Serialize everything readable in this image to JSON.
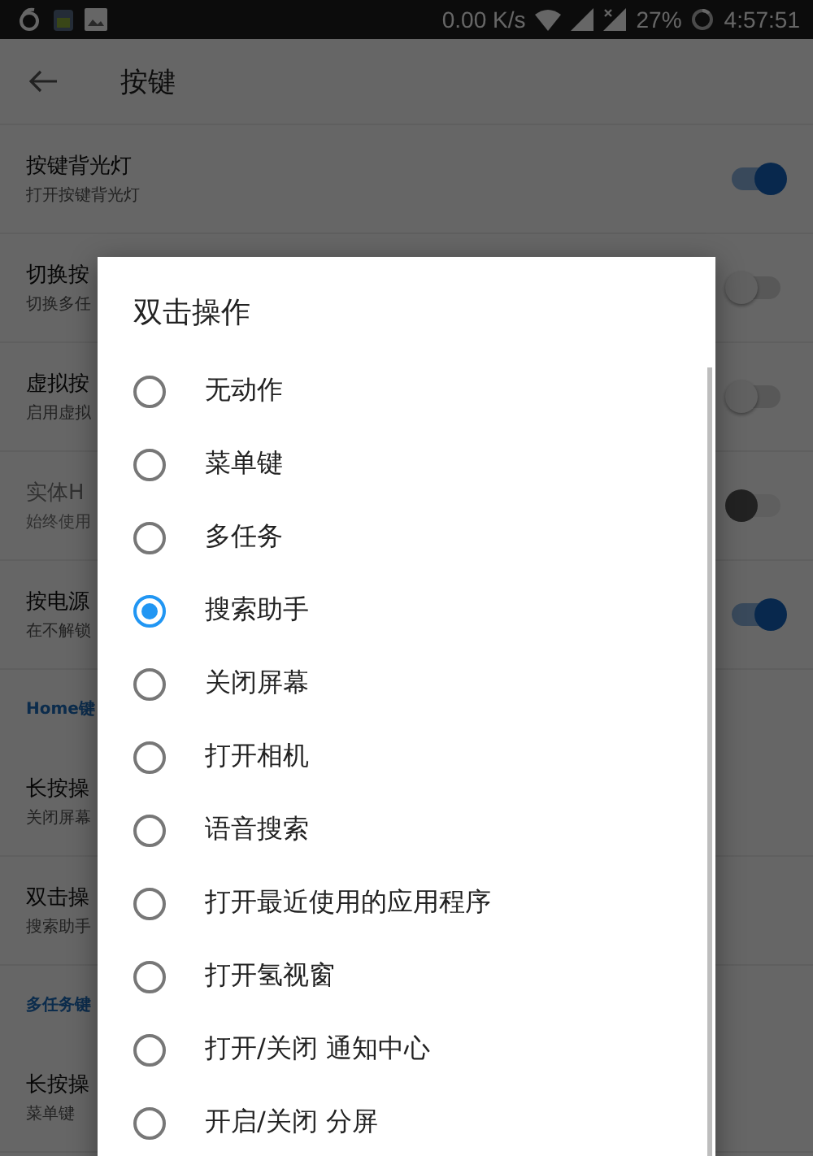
{
  "status_bar": {
    "speed": "0.00 K/s",
    "battery": "27%",
    "time": "4:57:51"
  },
  "toolbar": {
    "title": "按键"
  },
  "settings": [
    {
      "kind": "row",
      "title": "按键背光灯",
      "subtitle": "打开按键背光灯",
      "on": true,
      "disabled": false
    },
    {
      "kind": "row",
      "title": "切换按",
      "subtitle": "切换多任",
      "on": false,
      "disabled": false
    },
    {
      "kind": "row",
      "title": "虚拟按",
      "subtitle": "启用虚拟",
      "on": false,
      "disabled": false
    },
    {
      "kind": "row",
      "title": "实体H",
      "subtitle": "始终使用",
      "on": false,
      "disabled": true
    },
    {
      "kind": "row",
      "title": "按电源",
      "subtitle": "在不解锁",
      "on": true,
      "disabled": false
    },
    {
      "kind": "header",
      "title": "Home键"
    },
    {
      "kind": "plain",
      "title": "长按操",
      "subtitle": "关闭屏幕"
    },
    {
      "kind": "plain",
      "title": "双击操",
      "subtitle": "搜索助手"
    },
    {
      "kind": "header",
      "title": "多任务键"
    },
    {
      "kind": "plain",
      "title": "长按操",
      "subtitle": "菜单键"
    }
  ],
  "dialog": {
    "title": "双击操作",
    "options": [
      {
        "label": "无动作",
        "selected": false
      },
      {
        "label": "菜单键",
        "selected": false
      },
      {
        "label": "多任务",
        "selected": false
      },
      {
        "label": "搜索助手",
        "selected": true
      },
      {
        "label": "关闭屏幕",
        "selected": false
      },
      {
        "label": "打开相机",
        "selected": false
      },
      {
        "label": "语音搜索",
        "selected": false
      },
      {
        "label": "打开最近使用的应用程序",
        "selected": false
      },
      {
        "label": "打开氢视窗",
        "selected": false
      },
      {
        "label": "打开/关闭 通知中心",
        "selected": false
      },
      {
        "label": "开启/关闭 分屏",
        "selected": false
      }
    ]
  }
}
